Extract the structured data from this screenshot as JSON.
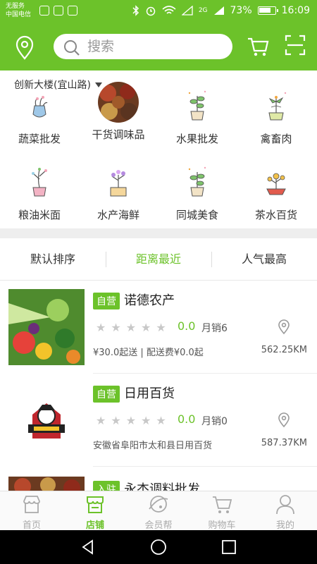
{
  "status_bar": {
    "carrier_line1": "无服务",
    "carrier_line2": "中国电信",
    "network": "2G",
    "battery": "73%",
    "time": "16:09"
  },
  "header": {
    "search_placeholder": "搜索",
    "location": "创新大楼(宜山路)",
    "accent_color": "#6cc22a"
  },
  "categories": [
    {
      "label": "蔬菜批发",
      "icon": "vegetable-vase-icon"
    },
    {
      "label": "干货调味品",
      "icon": "spices-photo"
    },
    {
      "label": "水果批发",
      "icon": "fruit-plant-icon"
    },
    {
      "label": "禽畜肉",
      "icon": "meat-plant-icon"
    },
    {
      "label": "粮油米面",
      "icon": "grain-plant-icon"
    },
    {
      "label": "水产海鲜",
      "icon": "seafood-plant-icon"
    },
    {
      "label": "同城美食",
      "icon": "food-plant-icon"
    },
    {
      "label": "茶水百货",
      "icon": "tea-flower-icon"
    }
  ],
  "sort_tabs": [
    {
      "label": "默认排序",
      "active": false
    },
    {
      "label": "距离最近",
      "active": true
    },
    {
      "label": "人气最高",
      "active": false
    }
  ],
  "shops": [
    {
      "badge": "自营",
      "name": "诺德农产",
      "rating": "0.0",
      "sales": "月销6",
      "info": "¥30.0起送 | 配送费¥0.0起",
      "distance": "562.25KM",
      "stars": 0
    },
    {
      "badge": "自营",
      "name": "日用百货",
      "rating": "0.0",
      "sales": "月销0",
      "info": "安徽省阜阳市太和县日用百货",
      "distance": "587.37KM",
      "stars": 0
    },
    {
      "badge": "入驻",
      "name": "永杰调料批发"
    }
  ],
  "bottom_nav": [
    {
      "label": "首页",
      "icon": "home-store-icon",
      "active": false
    },
    {
      "label": "店铺",
      "icon": "shop-icon",
      "active": true
    },
    {
      "label": "会员帮",
      "icon": "member-planet-icon",
      "active": false
    },
    {
      "label": "购物车",
      "icon": "cart-icon",
      "active": false
    },
    {
      "label": "我的",
      "icon": "profile-icon",
      "active": false
    }
  ]
}
